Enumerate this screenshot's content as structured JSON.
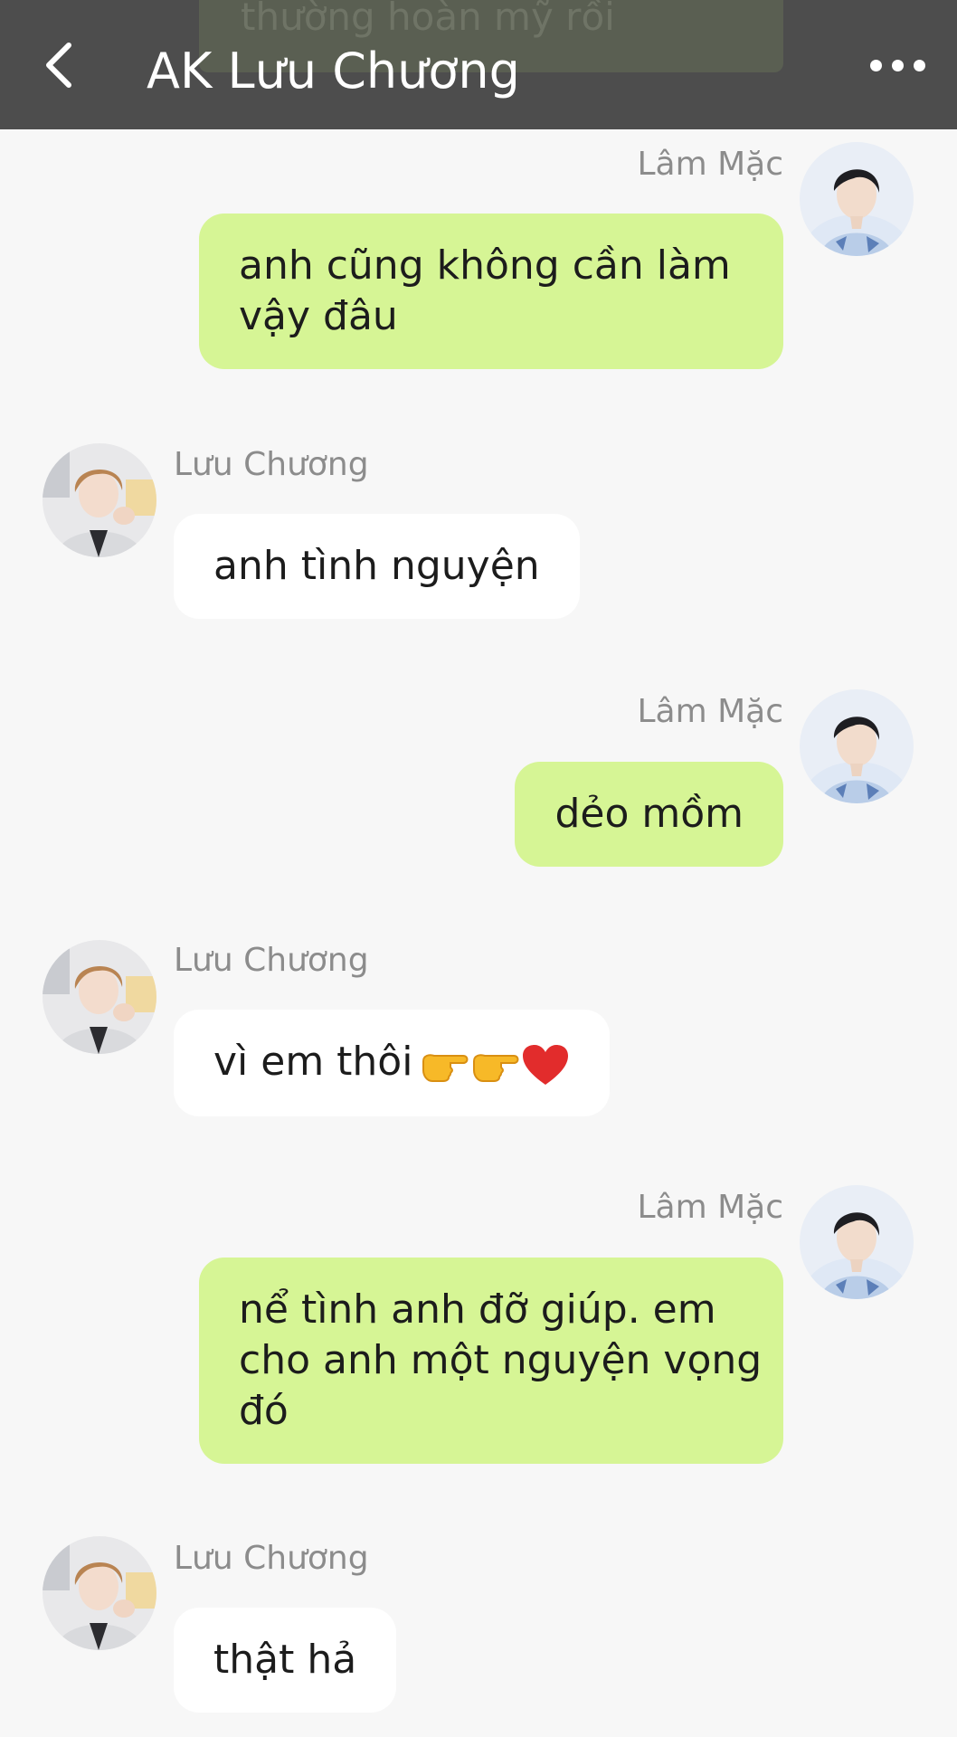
{
  "header": {
    "title": "AK Lưu Chương",
    "peek_text": "thường hoàn mỹ rồi",
    "back_icon": "back-arrow-icon",
    "more_icon": "more-dots-icon"
  },
  "colors": {
    "header_bg": "#4d4d4d",
    "outgoing_bubble": "#d6f595",
    "incoming_bubble": "#ffffff",
    "background": "#f7f7f7",
    "sender_name": "#8c8c8c"
  },
  "messages": [
    {
      "side": "out",
      "sender": "Lâm Mặc",
      "lines": [
        "anh cũng không cần làm",
        "vậy đâu"
      ]
    },
    {
      "side": "in",
      "sender": "Lưu Chương",
      "lines": [
        "anh tình nguyện"
      ]
    },
    {
      "side": "out",
      "sender": "Lâm Mặc",
      "lines": [
        "dẻo mồm"
      ]
    },
    {
      "side": "in",
      "sender": "Lưu Chương",
      "lines": [
        "vì em thôi"
      ],
      "emojis": [
        "pointing-right-emoji",
        "pointing-right-emoji",
        "red-heart-emoji"
      ]
    },
    {
      "side": "out",
      "sender": "Lâm Mặc",
      "lines": [
        "nể tình anh đỡ giúp. em",
        "cho anh một nguyện vọng",
        "đó"
      ]
    },
    {
      "side": "in",
      "sender": "Lưu Chương",
      "lines": [
        "thật hả"
      ]
    }
  ]
}
